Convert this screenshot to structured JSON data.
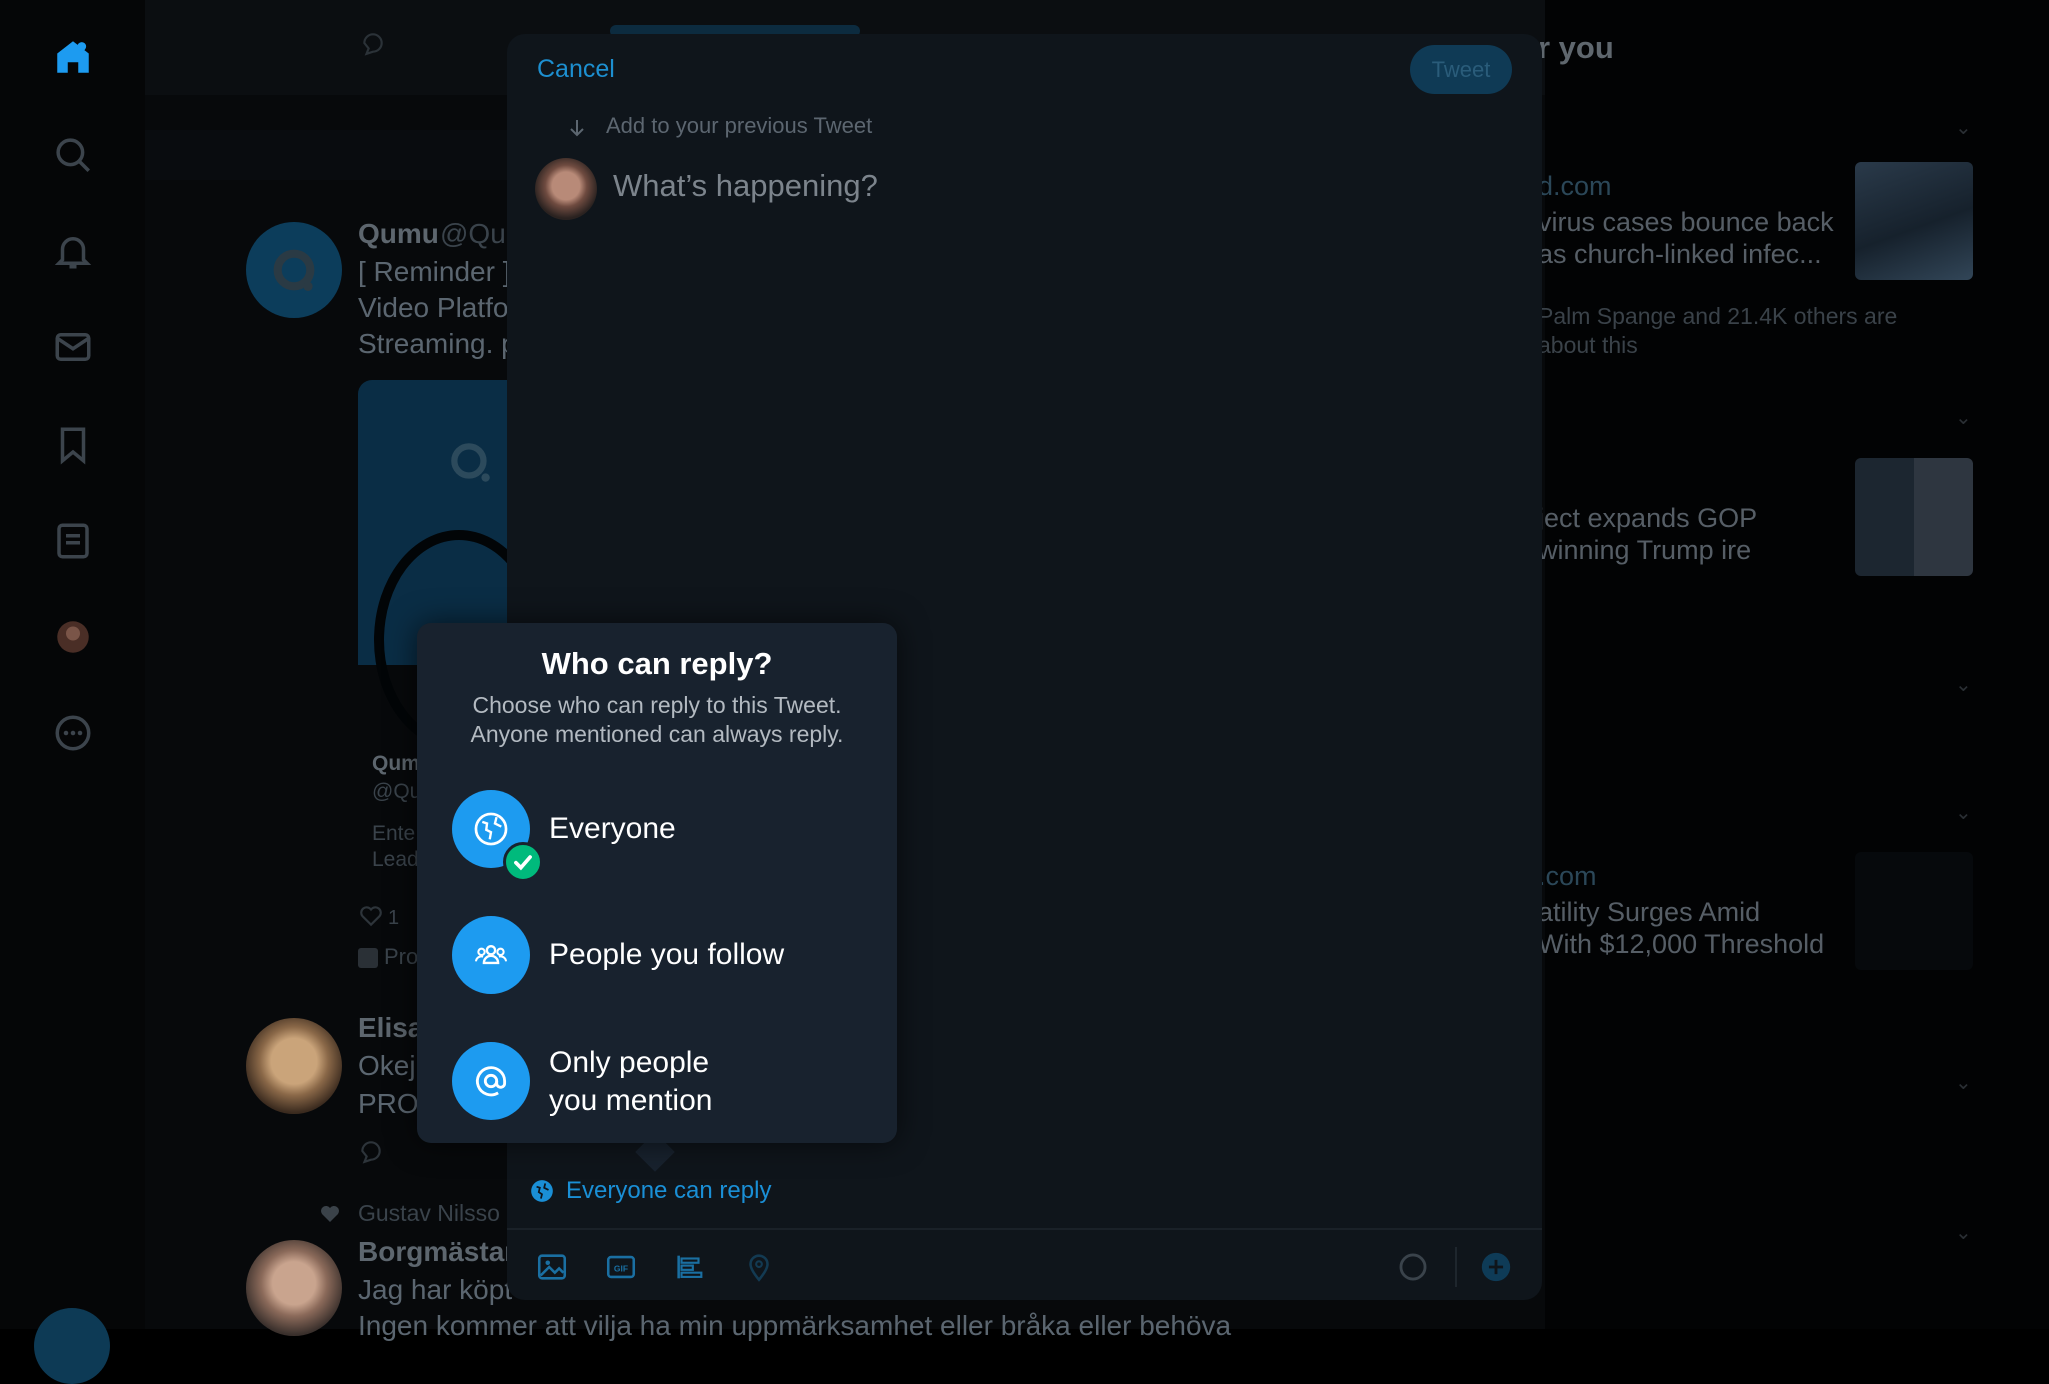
{
  "compose": {
    "cancel_label": "Cancel",
    "tweet_label": "Tweet",
    "add_previous": "Add to your previous Tweet",
    "placeholder": "What’s happening?",
    "reply_setting": "Everyone can reply"
  },
  "reply_popover": {
    "title": "Who can reply?",
    "description_line1": "Choose who can reply to this Tweet.",
    "description_line2": "Anyone mentioned can always reply.",
    "options": [
      {
        "label": "Everyone",
        "icon": "globe-icon",
        "selected": true
      },
      {
        "label": "People you follow",
        "icon": "people-icon",
        "selected": false
      },
      {
        "label_line1": "Only people",
        "label_line2": "you mention",
        "icon": "at-icon",
        "selected": false
      }
    ]
  },
  "background": {
    "post1_name": "Qumu",
    "post1_handle": "@Qu",
    "post1_line1": "[ Reminder ]",
    "post1_line2": "Video Platfo",
    "post1_line3": "Streaming. p",
    "card_name": "Qum",
    "card_handle": "@Qu",
    "card_line1": "Ente",
    "card_line2": "Lead",
    "like_count": "1",
    "promoted": "Pro",
    "post2_name": "Elisa",
    "post2_line1": "Okej.",
    "post2_line2": "PRO",
    "liked_by": "Gustav Nilsso",
    "post3_name": "Borgmästar",
    "post3_line1": "Jag har köpt",
    "post3_line2": "Ingen kommer att vilja ha min uppmärksamhet eller bråka eller behöva"
  },
  "sidebar_right": {
    "header": "r you",
    "story1_source": "d.com",
    "story1_line1": "virus cases bounce back",
    "story1_line2": "as church-linked infec...",
    "story1_social1": "Palm Spange and 21.4K others are",
    "story1_social2": "about this",
    "story2_line1": "ject expands GOP",
    "story2_line2": "winning Trump ire",
    "story3_source": ".com",
    "story3_line1": "atility Surges Amid",
    "story3_line2": "With $12,000 Threshold"
  },
  "colors": {
    "accent": "#1d9bf0",
    "success": "#00ba7c",
    "modal_bg": "#0f151b",
    "popover_bg": "#18222e"
  }
}
